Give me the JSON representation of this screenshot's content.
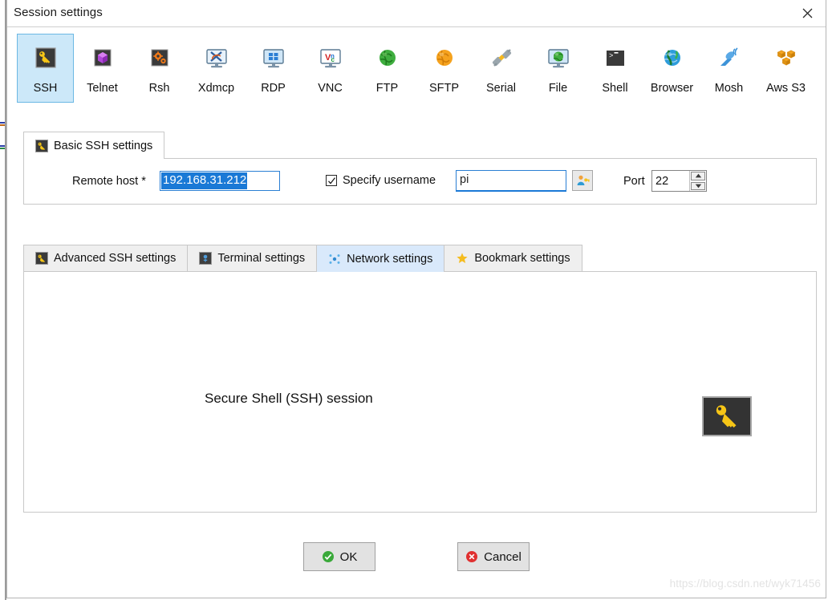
{
  "window": {
    "title": "Session settings",
    "close_icon": "close-icon"
  },
  "protocols": [
    {
      "label": "SSH",
      "icon": "ssh-key-icon",
      "selected": true
    },
    {
      "label": "Telnet",
      "icon": "telnet-cube-icon",
      "selected": false
    },
    {
      "label": "Rsh",
      "icon": "rsh-gears-icon",
      "selected": false
    },
    {
      "label": "Xdmcp",
      "icon": "xdmcp-monitor-icon",
      "selected": false
    },
    {
      "label": "RDP",
      "icon": "rdp-monitor-icon",
      "selected": false
    },
    {
      "label": "VNC",
      "icon": "vnc-monitor-icon",
      "selected": false
    },
    {
      "label": "FTP",
      "icon": "ftp-globe-icon",
      "selected": false
    },
    {
      "label": "SFTP",
      "icon": "sftp-globe-icon",
      "selected": false
    },
    {
      "label": "Serial",
      "icon": "serial-plug-icon",
      "selected": false
    },
    {
      "label": "File",
      "icon": "file-monitor-icon",
      "selected": false
    },
    {
      "label": "Shell",
      "icon": "shell-console-icon",
      "selected": false
    },
    {
      "label": "Browser",
      "icon": "browser-globe-icon",
      "selected": false
    },
    {
      "label": "Mosh",
      "icon": "mosh-satellite-icon",
      "selected": false
    },
    {
      "label": "Aws S3",
      "icon": "aws-s3-boxes-icon",
      "selected": false
    }
  ],
  "basic_ssh": {
    "tab_label": "Basic SSH settings",
    "tab_icon": "ssh-key-icon",
    "remote_host": {
      "label": "Remote host *",
      "value": "192.168.31.212",
      "placeholder": "",
      "selected_text": true
    },
    "specify_username": {
      "label": "Specify username",
      "checked": true,
      "check_glyph": "✓"
    },
    "username": {
      "value": "pi",
      "placeholder": "",
      "picker_icon": "user-key-icon"
    },
    "port": {
      "label": "Port",
      "value": "22",
      "up_glyph": "▲",
      "down_glyph": "▼"
    }
  },
  "lower_tabs": [
    {
      "label": "Advanced SSH settings",
      "icon": "ssh-key-icon",
      "active": false
    },
    {
      "label": "Terminal settings",
      "icon": "terminal-icon",
      "active": false
    },
    {
      "label": "Network settings",
      "icon": "network-nodes-icon",
      "active": true
    },
    {
      "label": "Bookmark settings",
      "icon": "star-icon",
      "active": false
    }
  ],
  "network_panel": {
    "description": "Secure Shell (SSH) session",
    "badge_icon": "ssh-key-icon"
  },
  "footer": {
    "ok_label": "OK",
    "ok_icon": "check-circle-icon",
    "cancel_label": "Cancel",
    "cancel_icon": "error-circle-icon"
  },
  "watermark": {
    "text": "https://blog.csdn.net/wyk71456"
  },
  "colors": {
    "selection_blue": "#1a79d6",
    "selected_tab_bg": "#cce8f9",
    "active_tab_tint": "#d9e9fb",
    "button_face": "#e2e2e2",
    "ok_green": "#3aa93a",
    "cancel_red": "#e03030",
    "key_gold": "#f6c516",
    "panel_border": "#c8c8c8"
  }
}
